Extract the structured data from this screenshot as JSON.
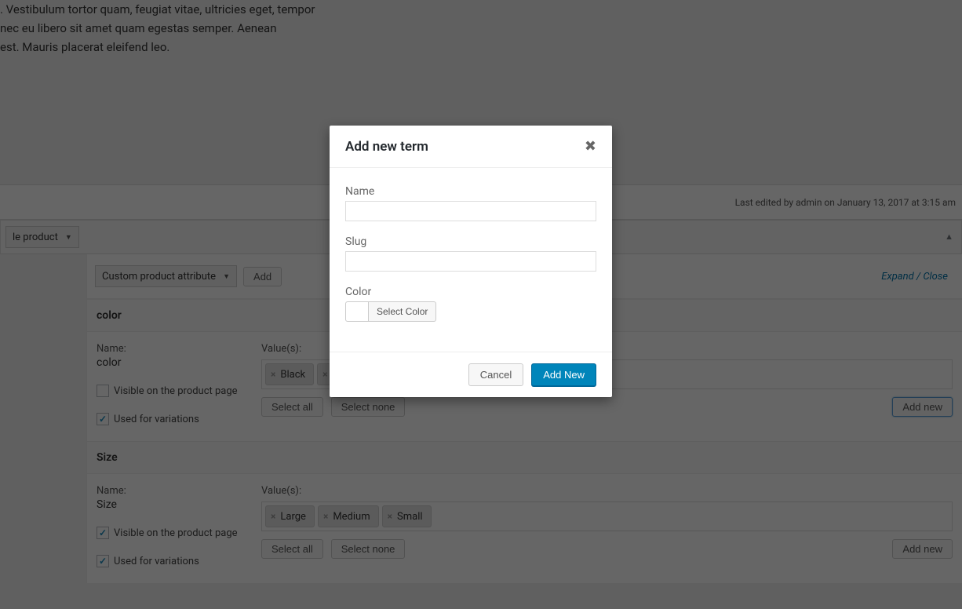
{
  "bg": {
    "line1": ". Vestibulum tortor quam, feugiat vitae, ultricies eget, tempor",
    "line2": "nec eu libero sit amet quam egestas semper. Aenean",
    "line3": "est. Mauris placerat eleifend leo."
  },
  "status": {
    "text": "Last edited by admin on January 13, 2017 at 3:15 am"
  },
  "product_header": {
    "type_value": "le product",
    "collapse_glyph": "▲"
  },
  "attr_toolbar": {
    "select_value": "Custom product attribute",
    "add_label": "Add",
    "expand_close_label": "Expand / Close"
  },
  "attributes": [
    {
      "header": "color",
      "name_label": "Name:",
      "name_value": "color",
      "visible_label": "Visible on the product page",
      "visible_checked": false,
      "variations_label": "Used for variations",
      "variations_checked": true,
      "values_label": "Value(s):",
      "tags": [
        "Black"
      ],
      "partial_tag": true,
      "select_all_label": "Select all",
      "select_none_label": "Select none",
      "add_new_label": "Add new",
      "add_new_highlighted": true
    },
    {
      "header": "Size",
      "name_label": "Name:",
      "name_value": "Size",
      "visible_label": "Visible on the product page",
      "visible_checked": true,
      "variations_label": "Used for variations",
      "variations_checked": true,
      "values_label": "Value(s):",
      "tags": [
        "Large",
        "Medium",
        "Small"
      ],
      "partial_tag": false,
      "select_all_label": "Select all",
      "select_none_label": "Select none",
      "add_new_label": "Add new",
      "add_new_highlighted": false
    }
  ],
  "modal": {
    "title": "Add new term",
    "name_label": "Name",
    "name_value": "",
    "slug_label": "Slug",
    "slug_value": "",
    "color_label": "Color",
    "select_color_label": "Select Color",
    "cancel_label": "Cancel",
    "add_new_label": "Add New"
  }
}
